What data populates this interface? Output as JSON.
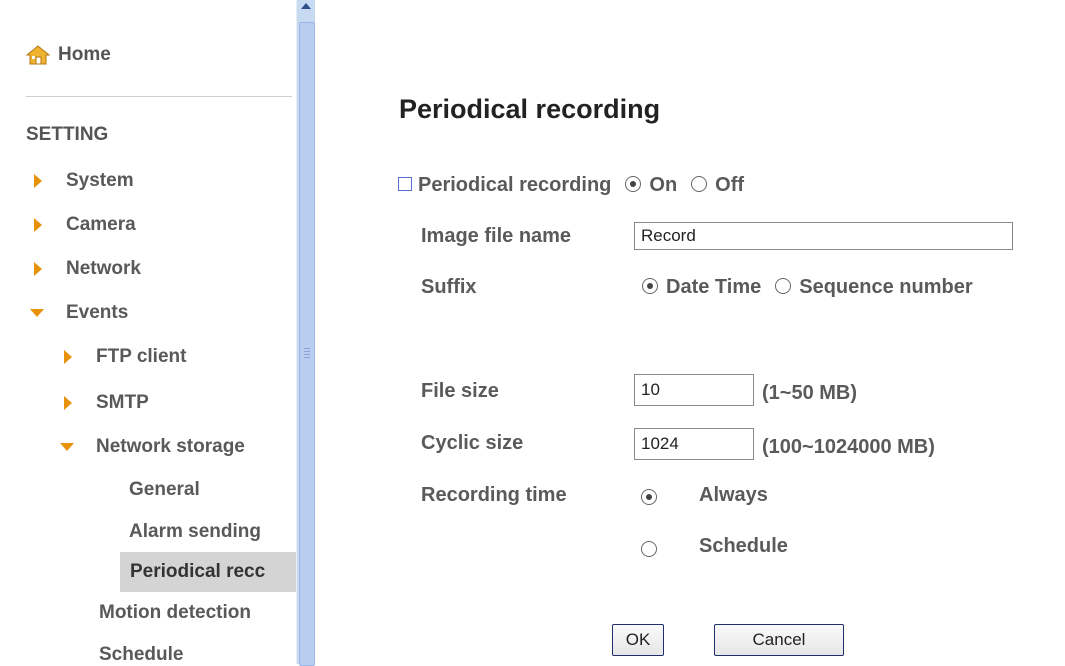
{
  "sidebar": {
    "home_label": "Home",
    "section_title": "SETTING",
    "items": [
      {
        "label": "System"
      },
      {
        "label": "Camera"
      },
      {
        "label": "Network"
      },
      {
        "label": "Events"
      },
      {
        "label": "FTP client"
      },
      {
        "label": "SMTP"
      },
      {
        "label": "Network storage"
      },
      {
        "label": "General"
      },
      {
        "label": "Alarm sending"
      },
      {
        "label": "Periodical recc"
      },
      {
        "label": "Motion detection"
      },
      {
        "label": "Schedule"
      }
    ]
  },
  "main": {
    "title": "Periodical recording",
    "periodical": {
      "label": "Periodical recording",
      "on_label": "On",
      "off_label": "Off",
      "selected": "On"
    },
    "image_file_name": {
      "label": "Image file name",
      "value": "Record"
    },
    "suffix": {
      "label": "Suffix",
      "date_time_label": "Date Time",
      "sequence_label": "Sequence number",
      "selected": "Date Time"
    },
    "file_size": {
      "label": "File size",
      "value": "10",
      "range": "(1~50 MB)"
    },
    "cyclic_size": {
      "label": "Cyclic size",
      "value": "1024",
      "range": "(100~1024000 MB)"
    },
    "recording_time": {
      "label": "Recording time",
      "always_label": "Always",
      "schedule_label": "Schedule",
      "selected": "Always"
    },
    "buttons": {
      "ok": "OK",
      "cancel": "Cancel"
    }
  },
  "colors": {
    "arrow": "#e8920c",
    "active_item_bg": "#d4d4d4",
    "scrollbar": "#c8d9f2"
  }
}
